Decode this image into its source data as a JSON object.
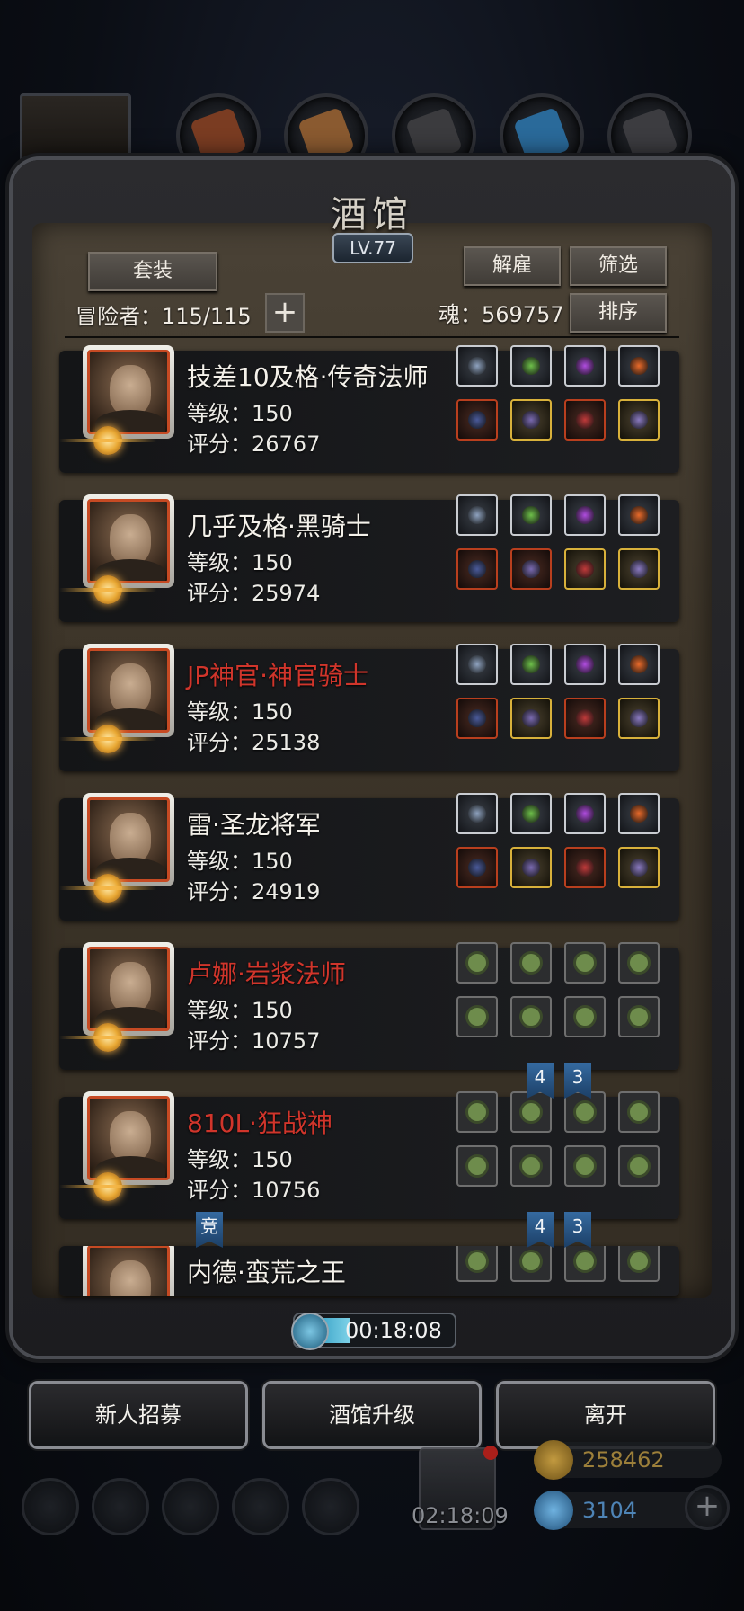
{
  "header": {
    "title": "酒馆",
    "level": "LV.77",
    "tabs": [
      {
        "icon": "brown-item-icon",
        "color": "#8a4a2a"
      },
      {
        "icon": "wood-plank-icon",
        "color": "#8a5a30"
      },
      {
        "icon": "dark-stone-icon",
        "color": "#3a3a3c"
      },
      {
        "icon": "blue-feather-icon",
        "color": "#2a6a9a"
      },
      {
        "icon": "gray-block-icon",
        "color": "#3c3c40"
      }
    ]
  },
  "controls": {
    "set_label": "套装",
    "dismiss_label": "解雇",
    "filter_label": "筛选",
    "sort_label": "排序",
    "adventurers_label": "冒险者：115/115",
    "plus_label": "+",
    "soul_label": "魂：569757"
  },
  "heroes": [
    {
      "name": "技差10及格·传奇法师",
      "red": false,
      "level": "等级：150",
      "score": "评分：26767",
      "equip": [
        "gray",
        "gray",
        "gray",
        "gray",
        "red",
        "gold",
        "red",
        "gold"
      ]
    },
    {
      "name": "几乎及格·黑骑士",
      "red": false,
      "level": "等级：150",
      "score": "评分：25974",
      "equip": [
        "gray",
        "gray",
        "gray",
        "gray",
        "red",
        "red",
        "gold",
        "gold"
      ]
    },
    {
      "name": "JP神官·神官骑士",
      "red": true,
      "level": "等级：150",
      "score": "评分：25138",
      "equip": [
        "gray",
        "gray",
        "gray",
        "gray",
        "red",
        "gold",
        "red",
        "gold"
      ]
    },
    {
      "name": "雷·圣龙将军",
      "red": false,
      "level": "等级：150",
      "score": "评分：24919",
      "equip": [
        "gray",
        "gray",
        "gray",
        "gray",
        "red",
        "gold",
        "red",
        "gold"
      ]
    },
    {
      "name": "卢娜·岩浆法师",
      "red": true,
      "level": "等级：150",
      "score": "评分：10757",
      "equip": [
        "empty",
        "empty",
        "empty",
        "empty",
        "empty",
        "empty",
        "empty",
        "empty"
      ]
    },
    {
      "name": "810L·狂战神",
      "red": true,
      "level": "等级：150",
      "score": "评分：10756",
      "equip": [
        "empty",
        "empty",
        "empty",
        "empty",
        "empty",
        "empty",
        "empty",
        "empty"
      ]
    },
    {
      "name": "内德·蛮荒之王",
      "red": false,
      "level": "",
      "score": "",
      "equip": [
        "empty",
        "empty",
        "empty",
        "empty"
      ]
    }
  ],
  "badges": {
    "row5": [
      "4",
      "3"
    ],
    "row6": [
      "竞",
      "4",
      "3"
    ]
  },
  "timer": "00:18:08",
  "bottom": {
    "recruit_label": "新人招募",
    "upgrade_label": "酒馆升级",
    "leave_label": "离开",
    "gift_timer": "02:18:09",
    "gold": "258462",
    "gems": "3104"
  }
}
